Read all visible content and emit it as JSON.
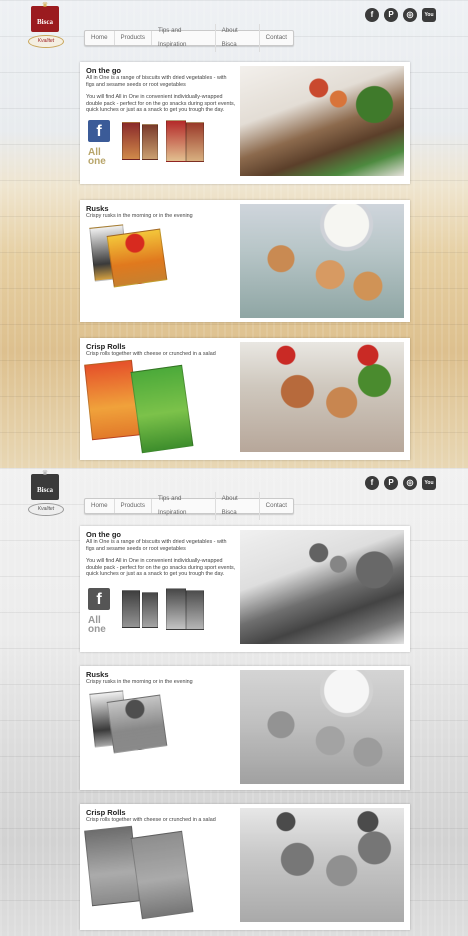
{
  "brand": {
    "name": "Bisca",
    "sub": "Kvalitet"
  },
  "social": [
    {
      "icon": "facebook-icon",
      "glyph": "f"
    },
    {
      "icon": "pinterest-icon",
      "glyph": "P"
    },
    {
      "icon": "instagram-icon",
      "glyph": "◎"
    },
    {
      "icon": "youtube-icon",
      "glyph": "You"
    }
  ],
  "nav": [
    "Home",
    "Products",
    "Tips and Inspiration",
    "About Bisca",
    "Contact"
  ],
  "sections": [
    {
      "title": "On the go",
      "text1": "All in One is a range of biscuits with dried vegetables - with figs and sesame seeds or root vegetables",
      "text2": "You will find All in One in convenient individually-wrapped double pack - perfect for on the go snacks during sport events, quick lunches or just as a snack to get you trough the day.",
      "fb": "f",
      "allone": [
        "All",
        "one"
      ]
    },
    {
      "title": "Rusks",
      "text1": "Crispy rusks in the morning or in the evening"
    },
    {
      "title": "Crisp Rolls",
      "text1": "Crisp rolls together with cheese or crunched in a salad"
    }
  ]
}
